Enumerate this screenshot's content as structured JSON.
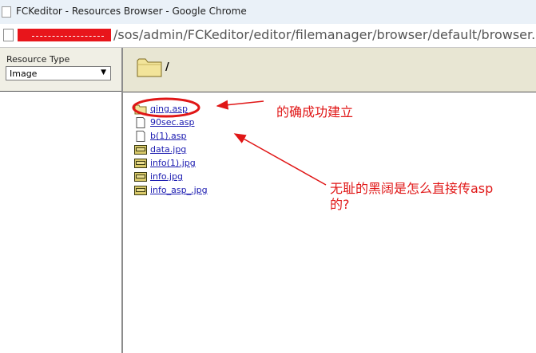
{
  "window": {
    "title": "FCKeditor - Resources Browser - Google Chrome"
  },
  "address_bar": {
    "url": "/sos/admin/FCKeditor/editor/filemanager/browser/default/browser.ht"
  },
  "left_panel": {
    "resource_type_label": "Resource Type",
    "resource_type_value": "Image"
  },
  "main": {
    "current_path": "/",
    "files": [
      {
        "name": "qing.asp",
        "icon": "folder-icon"
      },
      {
        "name": "90sec.asp",
        "icon": "file-icon"
      },
      {
        "name": "b(1).asp",
        "icon": "file-icon"
      },
      {
        "name": "data.jpg",
        "icon": "jpg-icon"
      },
      {
        "name": "info(1).jpg",
        "icon": "jpg-icon"
      },
      {
        "name": "info.jpg",
        "icon": "jpg-icon"
      },
      {
        "name": "info_asp_.jpg",
        "icon": "jpg-icon"
      }
    ]
  },
  "annotations": {
    "note_1": "的确成功建立",
    "note_2_line_1": "无耻的黑阔是怎么直接传asp",
    "note_2_line_2": "的?"
  },
  "colors": {
    "annotation_red": "#e01616",
    "link_blue": "#1a1ab0",
    "toolbar_beige": "#e8e6d3",
    "panel_beige": "#f0efe5"
  }
}
